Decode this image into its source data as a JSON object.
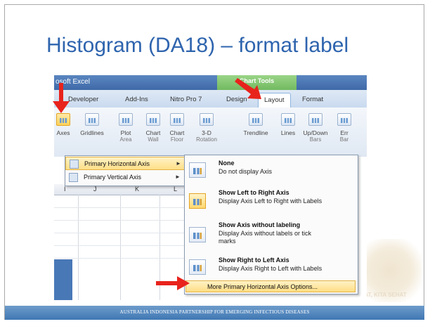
{
  "slide": {
    "title": "Histogram (DA18) – format label",
    "footer": "AUSTRALIA INDONESIA PARTNERSHIP FOR EMERGING INFECTIOUS DISEASES",
    "watermark": "HEWAN SEHAT, KITA SEHAT"
  },
  "excel": {
    "window_title": "osoft Excel",
    "chart_tools_label": "Chart Tools",
    "tabs": [
      "Developer",
      "Add-Ins",
      "Nitro Pro 7",
      "Design",
      "Layout",
      "Format"
    ],
    "active_tab": "Layout",
    "ribbon": {
      "axes": "Axes",
      "gridlines": "Gridlines",
      "plot_area": "Plot",
      "plot_area_sub": "Area",
      "chart_wall": "Chart",
      "chart_wall_sub": "Wall",
      "chart_floor": "Chart",
      "chart_floor_sub": "Floor",
      "rotation": "3-D",
      "rotation_sub": "Rotation",
      "trendline": "Trendline",
      "lines": "Lines",
      "updown": "Up/Down",
      "updown_sub": "Bars",
      "error": "Err",
      "error_sub": "Bar"
    },
    "columns": [
      "I",
      "J",
      "K",
      "L"
    ],
    "axes_menu": [
      {
        "label": "Primary Horizontal Axis",
        "highlighted": true
      },
      {
        "label": "Primary Vertical Axis",
        "highlighted": false
      }
    ],
    "submenu": [
      {
        "title": "None",
        "desc": "Do not display Axis",
        "selected": false
      },
      {
        "title": "Show Left to Right Axis",
        "desc": "Display Axis Left to Right with Labels",
        "selected": true
      },
      {
        "title": "Show Axis without labeling",
        "desc": "Display Axis without labels or tick marks",
        "selected": false
      },
      {
        "title": "Show Right to Left Axis",
        "desc": "Display Axis Right to Left with Labels",
        "selected": false
      }
    ],
    "more_options": "More Primary Horizontal Axis Options..."
  },
  "colors": {
    "title": "#2e64ae",
    "footer_bar": "#4f83bd",
    "arrow": "#e8231c",
    "menu_highlight": "#ffdf88"
  }
}
